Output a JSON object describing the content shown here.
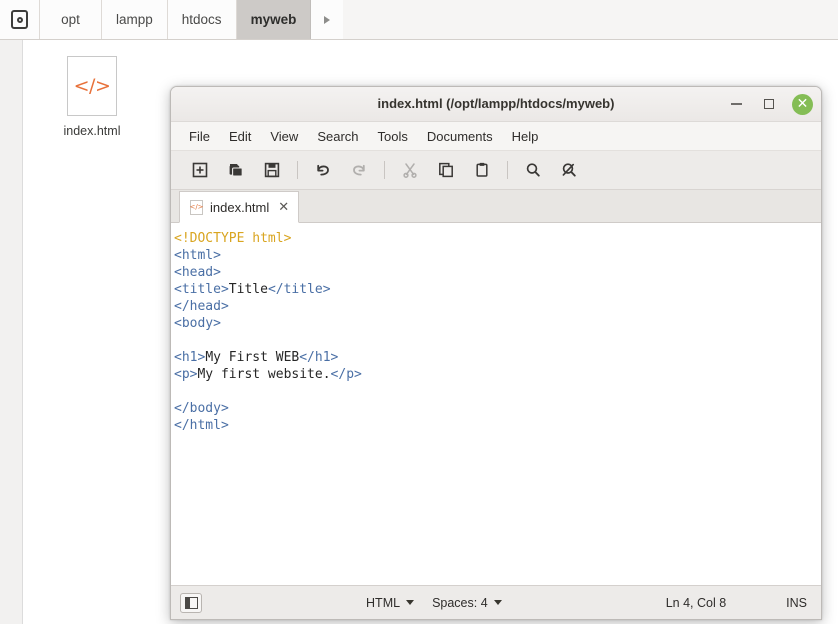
{
  "file_manager": {
    "breadcrumb": {
      "device_icon": "drive-icon",
      "items": [
        {
          "label": "opt",
          "active": false
        },
        {
          "label": "lampp",
          "active": false
        },
        {
          "label": "htdocs",
          "active": false
        },
        {
          "label": "myweb",
          "active": true
        }
      ],
      "next_arrow_icon": "chevron-right-icon"
    },
    "files": [
      {
        "name": "index.html",
        "icon": "html-file-icon",
        "glyph": "</>",
        "color": "#e8713a"
      }
    ]
  },
  "editor_window": {
    "title": "index.html (/opt/lampp/htdocs/myweb)",
    "window_controls": {
      "minimize": "minimize-icon",
      "maximize": "maximize-icon",
      "close": "✕",
      "close_color": "#84bd55"
    },
    "menubar": [
      "File",
      "Edit",
      "View",
      "Search",
      "Tools",
      "Documents",
      "Help"
    ],
    "toolbar": [
      {
        "name": "new-document-button",
        "icon": "new-document-icon",
        "enabled": true
      },
      {
        "name": "open-button",
        "icon": "open-folder-icon",
        "enabled": true
      },
      {
        "name": "save-button",
        "icon": "save-floppy-icon",
        "enabled": true
      },
      {
        "name": "separator-1",
        "icon": "separator",
        "enabled": true
      },
      {
        "name": "undo-button",
        "icon": "undo-arrow-icon",
        "enabled": true
      },
      {
        "name": "redo-button",
        "icon": "redo-arrow-icon",
        "enabled": false
      },
      {
        "name": "separator-2",
        "icon": "separator",
        "enabled": true
      },
      {
        "name": "cut-button",
        "icon": "scissors-icon",
        "enabled": false
      },
      {
        "name": "copy-button",
        "icon": "copy-icon",
        "enabled": true
      },
      {
        "name": "paste-button",
        "icon": "clipboard-icon",
        "enabled": true
      },
      {
        "name": "separator-3",
        "icon": "separator",
        "enabled": true
      },
      {
        "name": "find-button",
        "icon": "search-magnifier-icon",
        "enabled": true
      },
      {
        "name": "replace-button",
        "icon": "find-replace-icon",
        "enabled": true
      }
    ],
    "tab": {
      "label": "index.html",
      "icon": "html-file-icon",
      "glyph": "</>",
      "close": "✕"
    },
    "code_lines": [
      {
        "segments": [
          {
            "t": "<!DOCTYPE html>",
            "c": "doc"
          }
        ]
      },
      {
        "segments": [
          {
            "t": "<html>",
            "c": "tg"
          }
        ]
      },
      {
        "segments": [
          {
            "t": "<head>",
            "c": "tg"
          }
        ]
      },
      {
        "segments": [
          {
            "t": "<title>",
            "c": "tg"
          },
          {
            "t": "Title",
            "c": "txt"
          },
          {
            "t": "</title>",
            "c": "tg"
          }
        ]
      },
      {
        "segments": [
          {
            "t": "</head>",
            "c": "tg"
          }
        ]
      },
      {
        "segments": [
          {
            "t": "<body>",
            "c": "tg"
          }
        ]
      },
      {
        "segments": [
          {
            "t": "",
            "c": "txt"
          }
        ]
      },
      {
        "segments": [
          {
            "t": "<h1>",
            "c": "tg"
          },
          {
            "t": "My First WEB",
            "c": "txt"
          },
          {
            "t": "</h1>",
            "c": "tg"
          }
        ]
      },
      {
        "segments": [
          {
            "t": "<p>",
            "c": "tg"
          },
          {
            "t": "My first website.",
            "c": "txt"
          },
          {
            "t": "</p>",
            "c": "tg"
          }
        ]
      },
      {
        "segments": [
          {
            "t": "",
            "c": "txt"
          }
        ]
      },
      {
        "segments": [
          {
            "t": "</body>",
            "c": "tg"
          }
        ]
      },
      {
        "segments": [
          {
            "t": "</html>",
            "c": "tg"
          }
        ]
      }
    ],
    "statusbar": {
      "panel_toggle_icon": "side-panel-toggle-icon",
      "language": "HTML",
      "indentation": "Spaces: 4",
      "cursor_position": "Ln 4, Col 8",
      "insert_mode": "INS"
    }
  }
}
